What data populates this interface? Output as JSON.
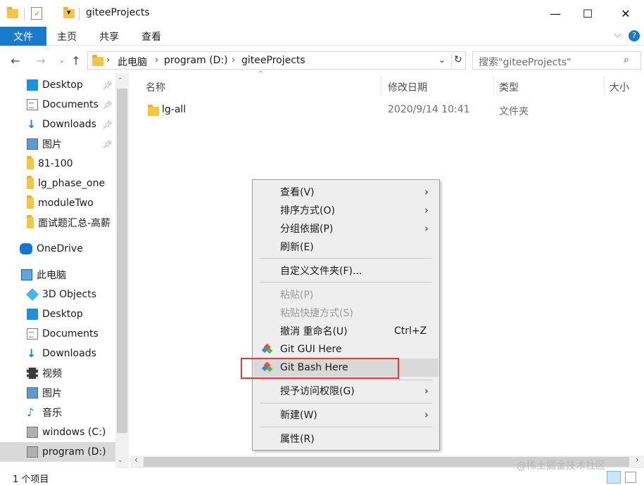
{
  "titlebar": {
    "title": "giteeProjects",
    "minimize": "—",
    "maximize": "☐",
    "close": "✕"
  },
  "ribbon": {
    "tabs": [
      "文件",
      "主页",
      "共享",
      "查看"
    ],
    "expand": "⌵",
    "help": "?"
  },
  "address": {
    "crumbs": [
      "此电脑",
      "program (D:)",
      "giteeProjects"
    ],
    "search_placeholder": "搜索\"giteeProjects\""
  },
  "sidebar": {
    "quick_access": [
      {
        "label": "Desktop",
        "icon": "desktop-icon",
        "pinned": true
      },
      {
        "label": "Documents",
        "icon": "documents-icon",
        "pinned": true
      },
      {
        "label": "Downloads",
        "icon": "downloads-icon",
        "pinned": true
      },
      {
        "label": "图片",
        "icon": "pictures-icon",
        "pinned": true
      },
      {
        "label": "81-100",
        "icon": "folder-icon",
        "pinned": false
      },
      {
        "label": "lg_phase_one",
        "icon": "folder-icon",
        "pinned": false
      },
      {
        "label": "moduleTwo",
        "icon": "folder-icon",
        "pinned": false
      },
      {
        "label": "面试题汇总-高薪",
        "icon": "folder-icon",
        "pinned": false
      }
    ],
    "onedrive": "OneDrive",
    "this_pc": "此电脑",
    "pc_items": [
      {
        "label": "3D Objects",
        "icon": "3d-objects-icon"
      },
      {
        "label": "Desktop",
        "icon": "desktop-icon"
      },
      {
        "label": "Documents",
        "icon": "documents-icon"
      },
      {
        "label": "Downloads",
        "icon": "downloads-icon"
      },
      {
        "label": "视频",
        "icon": "videos-icon"
      },
      {
        "label": "图片",
        "icon": "pictures-icon"
      },
      {
        "label": "音乐",
        "icon": "music-icon"
      },
      {
        "label": "windows (C:)",
        "icon": "drive-icon"
      },
      {
        "label": "program (D:)",
        "icon": "drive-icon",
        "selected": true
      }
    ]
  },
  "columns": {
    "name": "名称",
    "date": "修改日期",
    "type": "类型",
    "size": "大小"
  },
  "files": [
    {
      "name": "lg-all",
      "date": "2020/9/14 10:41",
      "type": "文件夹"
    }
  ],
  "context_menu": {
    "view": "查看(V)",
    "sort": "排序方式(O)",
    "group": "分组依据(P)",
    "refresh": "刷新(E)",
    "customize": "自定义文件夹(F)...",
    "paste": "粘贴(P)",
    "paste_shortcut": "粘贴快捷方式(S)",
    "undo": "撤消 重命名(U)",
    "undo_shortcut": "Ctrl+Z",
    "git_gui": "Git GUI Here",
    "git_bash": "Git Bash Here",
    "grant_access": "授予访问权限(G)",
    "new": "新建(W)",
    "properties": "属性(R)"
  },
  "status": {
    "count": "1 个项目"
  },
  "watermark": "@稀土掘金技术社区",
  "colors": {
    "accent": "#1979ca",
    "highlight_box": "#e03a3a",
    "folder": "#f4c642"
  }
}
